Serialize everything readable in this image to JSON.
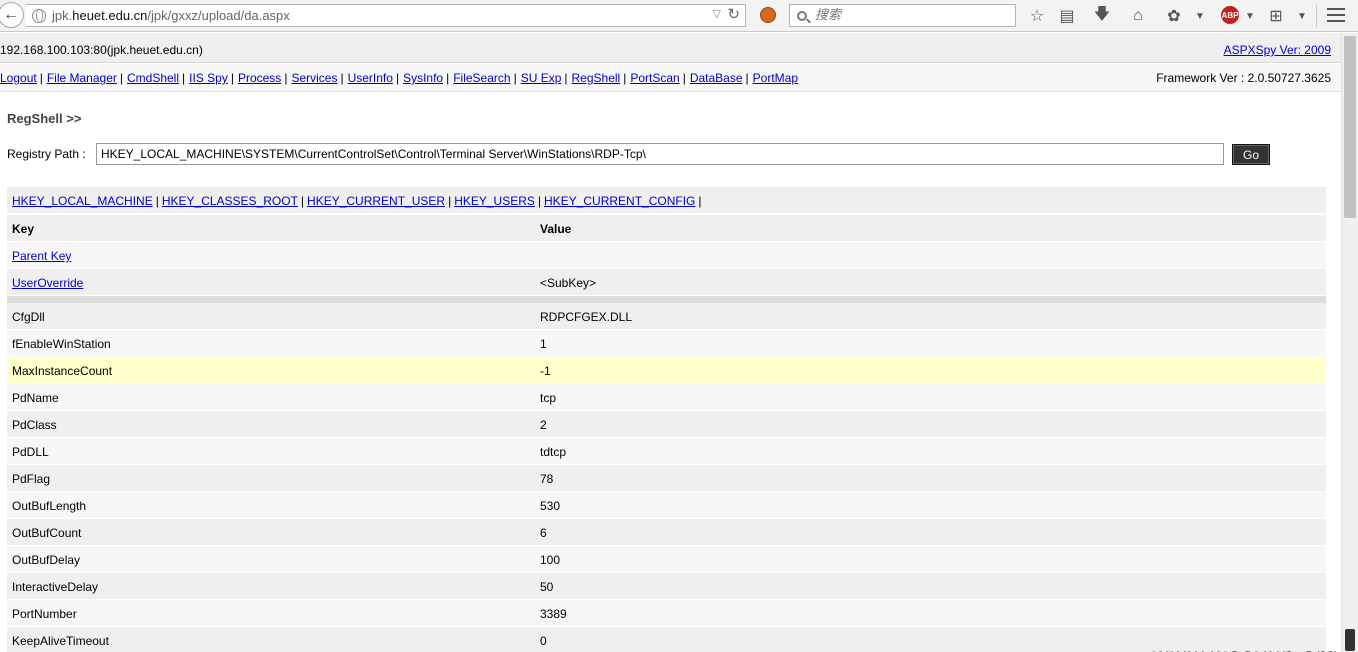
{
  "browser": {
    "url_prefix": "jpk.",
    "url_domain": "heuet.edu.cn",
    "url_path": "/jpk/gxxz/upload/da.aspx",
    "search_placeholder": "搜索",
    "abp_label": "ABP"
  },
  "header": {
    "host": "192.168.100.103:80(jpk.heuet.edu.cn)",
    "version_link": "ASPXSpy Ver: 2009",
    "framework": "Framework Ver : 2.0.50727.3625"
  },
  "nav": {
    "items": [
      "Logout",
      "File Manager",
      "CmdShell",
      "IIS Spy",
      "Process",
      "Services",
      "UserInfo",
      "SysInfo",
      "FileSearch",
      "SU Exp",
      "RegShell",
      "PortScan",
      "DataBase",
      "PortMap"
    ]
  },
  "regshell": {
    "title": "RegShell >>",
    "path_label": "Registry Path :",
    "path_value": "HKEY_LOCAL_MACHINE\\SYSTEM\\CurrentControlSet\\Control\\Terminal Server\\WinStations\\RDP-Tcp\\",
    "go_label": "Go"
  },
  "hives": [
    "HKEY_LOCAL_MACHINE",
    "HKEY_CLASSES_ROOT",
    "HKEY_CURRENT_USER",
    "HKEY_USERS",
    "HKEY_CURRENT_CONFIG"
  ],
  "table": {
    "key_header": "Key",
    "value_header": "Value",
    "parent_key": "Parent Key",
    "subkeys": [
      {
        "key": "UserOverride",
        "value": "<SubKey>"
      }
    ],
    "values": [
      {
        "key": "CfgDll",
        "value": "RDPCFGEX.DLL"
      },
      {
        "key": "fEnableWinStation",
        "value": "1"
      },
      {
        "key": "MaxInstanceCount",
        "value": "-1"
      },
      {
        "key": "PdName",
        "value": "tcp"
      },
      {
        "key": "PdClass",
        "value": "2"
      },
      {
        "key": "PdDLL",
        "value": "tdtcp"
      },
      {
        "key": "PdFlag",
        "value": "78"
      },
      {
        "key": "OutBufLength",
        "value": "530"
      },
      {
        "key": "OutBufCount",
        "value": "6"
      },
      {
        "key": "OutBufDelay",
        "value": "100"
      },
      {
        "key": "InteractiveDelay",
        "value": "50"
      },
      {
        "key": "PortNumber",
        "value": "3389"
      },
      {
        "key": "KeepAliveTimeout",
        "value": "0"
      }
    ],
    "highlight_color": "#ffffcc"
  },
  "watermark": "www.wooyun.org",
  "colors": {
    "link": "#0000cc",
    "row_odd": "#efefef",
    "row_even": "#f7f7f7"
  }
}
